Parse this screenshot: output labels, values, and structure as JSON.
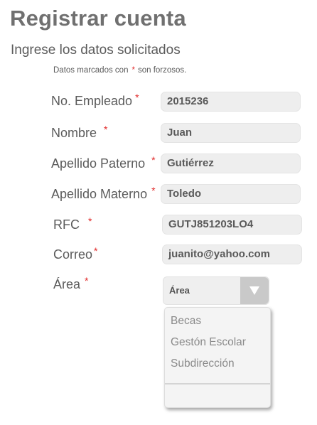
{
  "header": {
    "title": "Registrar cuenta",
    "subtitle": "Ingrese los datos solicitados"
  },
  "note": {
    "prefix": "Datos marcados con",
    "asterisk": "*",
    "suffix": "son forzosos."
  },
  "form": {
    "fields": [
      {
        "label": "No. Empleado",
        "value": "2015236"
      },
      {
        "label": "Nombre",
        "value": "Juan"
      },
      {
        "label": "Apellido Paterno",
        "value": "Gutiérrez"
      },
      {
        "label": "Apellido Materno",
        "value": "Toledo"
      },
      {
        "label": "RFC",
        "value": "GUTJ851203LO4"
      },
      {
        "label": "Correo",
        "value": "juanito@yahoo.com"
      }
    ],
    "area": {
      "label": "Área",
      "selected": "Área",
      "options": [
        "Becas",
        "Gestón Escolar",
        "Subdirección"
      ]
    },
    "required_mark": "*"
  },
  "colors": {
    "required": "#e12b2b",
    "field_bg": "#eeeeee",
    "arrow_bg": "#c9c9c9"
  },
  "icons": {
    "select_arrow": "triangle-down-icon"
  }
}
